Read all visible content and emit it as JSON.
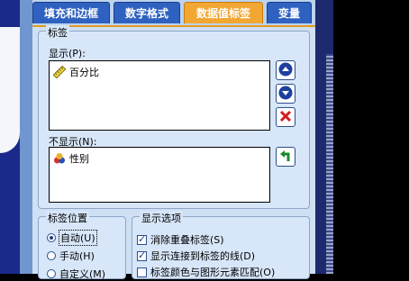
{
  "tabs": [
    {
      "label": "填充和边框"
    },
    {
      "label": "数字格式"
    },
    {
      "label": "数据值标签",
      "active": true
    },
    {
      "label": "变量"
    }
  ],
  "labels_group": {
    "title": "标签",
    "displayed_label": "显示(P):",
    "displayed_items": [
      {
        "label": "百分比",
        "icon": "ruler-icon"
      }
    ],
    "not_displayed_label": "不显示(N):",
    "not_displayed_items": [
      {
        "label": "性别",
        "icon": "nominal-variable-icon"
      }
    ]
  },
  "buttons": {
    "move_up": "up-arrow",
    "move_down": "down-arrow",
    "remove": "red-x",
    "move_back": "green-return-arrow"
  },
  "label_position": {
    "title": "标签位置",
    "options": [
      {
        "label": "自动(U)",
        "selected": true
      },
      {
        "label": "手动(H)",
        "selected": false
      },
      {
        "label": "自定义(M)",
        "selected": false
      }
    ]
  },
  "display_options": {
    "title": "显示选项",
    "options": [
      {
        "label": "消除重叠标签(S)",
        "checked": true
      },
      {
        "label": "显示连接到标签的线(D)",
        "checked": true
      },
      {
        "label": "标签颜色与图形元素匹配(O)",
        "checked": false
      }
    ]
  },
  "colors": {
    "active_tab": "#f2a733",
    "tab": "#2f62c0",
    "dialog_bg": "#cfe0f5"
  }
}
